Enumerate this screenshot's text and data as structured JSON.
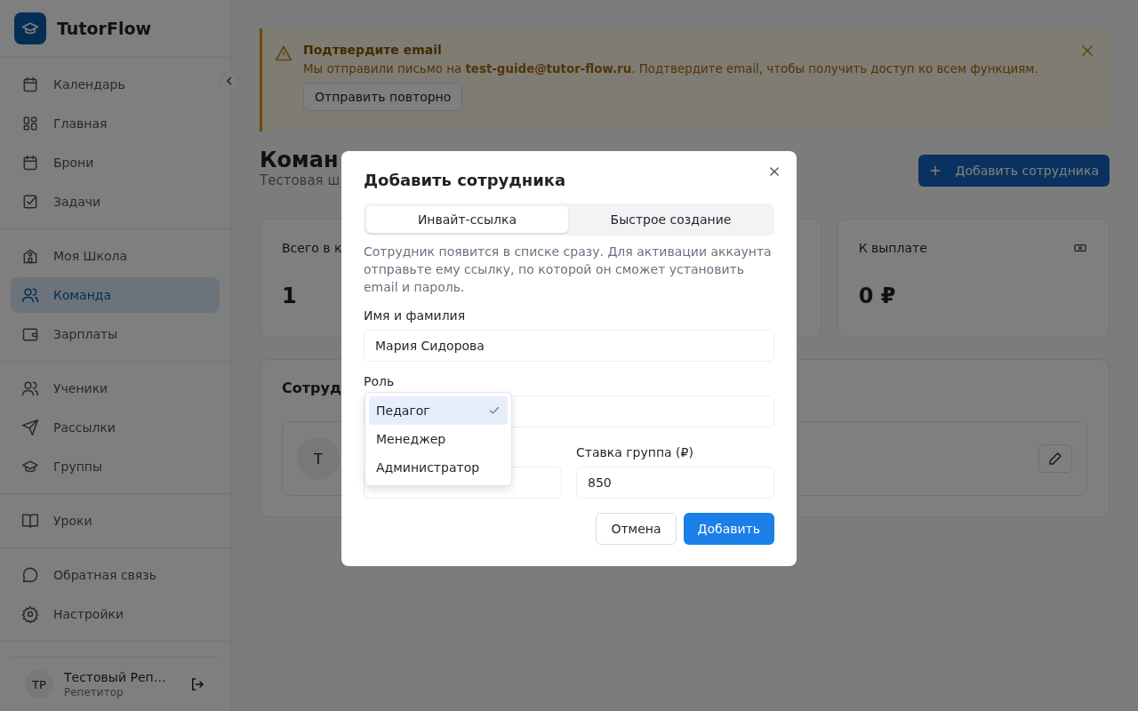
{
  "app": {
    "name": "TutorFlow"
  },
  "sidebar": {
    "groups": [
      [
        {
          "label": "Календарь",
          "selected": false
        },
        {
          "label": "Главная",
          "selected": false
        },
        {
          "label": "Брони",
          "selected": false
        },
        {
          "label": "Задачи",
          "selected": false
        }
      ],
      [
        {
          "label": "Моя Школа",
          "selected": false
        },
        {
          "label": "Команда",
          "selected": true
        },
        {
          "label": "Зарплаты",
          "selected": false
        }
      ],
      [
        {
          "label": "Ученики",
          "selected": false
        },
        {
          "label": "Рассылки",
          "selected": false
        },
        {
          "label": "Группы",
          "selected": false
        }
      ],
      [
        {
          "label": "Уроки",
          "selected": false
        }
      ],
      [
        {
          "label": "Обратная связь",
          "selected": false
        },
        {
          "label": "Настройки",
          "selected": false
        }
      ]
    ],
    "user": {
      "initials": "ТР",
      "name": "Тестовый Реп…",
      "role": "Репетитор"
    }
  },
  "banner": {
    "title": "Подтвердите email",
    "text": "Мы отправили письмо на **test-guide@tutor-flow.ru**. Подтвердите email, чтобы получить доступ ко всем функциям.",
    "button": "Отправить повторно"
  },
  "page": {
    "title": "Коман",
    "subtitle": "Тестовая ш",
    "add_button": "Добавить сотрудника"
  },
  "stats": [
    {
      "label": "Всего в к",
      "value": "1"
    },
    {
      "label": "К выплате",
      "value": "0 ₽"
    }
  ],
  "employees": {
    "title": "Сотруд",
    "rows": [
      {
        "initial": "Т"
      }
    ]
  },
  "modal": {
    "title": "Добавить сотрудника",
    "tabs": [
      {
        "label": "Инвайт-ссылка",
        "selected": true
      },
      {
        "label": "Быстрое создание",
        "selected": false
      }
    ],
    "description": "Сотрудник появится в списке сразу. Для активации аккаунта отправьте ему ссылку, по которой он сможет установить email и пароль.",
    "name_field": {
      "label": "Имя и фамилия",
      "value": "Мария Сидорова"
    },
    "role": {
      "label": "Роль",
      "options": [
        {
          "label": "Педагог",
          "selected": true
        },
        {
          "label": "Менеджер",
          "selected": false
        },
        {
          "label": "Администратор",
          "selected": false
        }
      ]
    },
    "rate_field": {
      "label": "Ставка группа (₽)",
      "value": "850"
    },
    "buttons": {
      "cancel": "Отмена",
      "submit": "Добавить"
    }
  }
}
